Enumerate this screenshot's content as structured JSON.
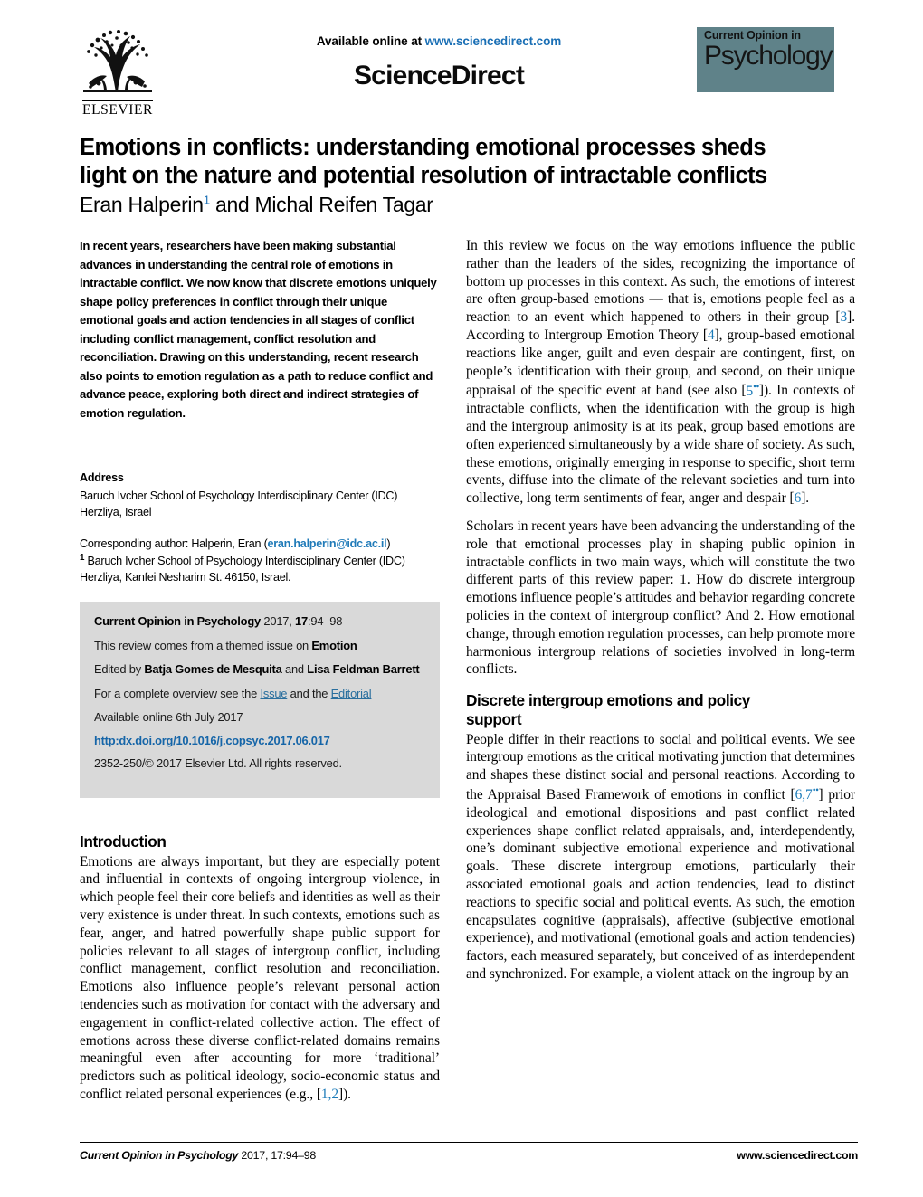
{
  "masthead": {
    "available_prefix": "Available online at ",
    "available_url": "www.sciencedirect.com",
    "sciencedirect_wordmark": "ScienceDirect",
    "elsevier_name": "ELSEVIER",
    "journal_logo_small": "Current Opinion in",
    "journal_logo_big": "Psychology",
    "journal_logo_bg": "#5f8289"
  },
  "title": {
    "line1": "Emotions in conflicts: understanding emotional processes sheds",
    "line2": "light on the nature and potential resolution of intractable conflicts",
    "authors_pre": "Eran Halperin",
    "authors_sup": "1",
    "authors_post": " and Michal Reifen Tagar"
  },
  "abstract": {
    "text": "In recent years, researchers have been making substantial advances in understanding the central role of emotions in intractable conflict. We now know that discrete emotions uniquely shape policy preferences in conflict through their unique emotional goals and action tendencies in all stages of conflict including conflict management, conflict resolution and reconciliation. Drawing on this understanding, recent research also points to emotion regulation as a path to reduce conflict and advance peace, exploring both direct and indirect strategies of emotion regulation."
  },
  "address": {
    "heading": "Address",
    "line1": "Baruch Ivcher School of Psychology Interdisciplinary Center (IDC)",
    "line2": "Herzliya, Israel",
    "corresponding_prefix": "Corresponding author: Halperin, Eran (",
    "corresponding_email": "eran.halperin@idc.ac.il",
    "corresponding_suffix": ")",
    "footnote_marker": "1",
    "footnote_line1": " Baruch Ivcher School of Psychology Interdisciplinary Center (IDC)",
    "footnote_line2": "Herzliya, Kanfei Nesharim St. 46150, Israel."
  },
  "meta": {
    "citation_journal": "Current Opinion in Psychology",
    "citation_year": " 2017, ",
    "citation_volume": "17",
    "citation_pages": ":94–98",
    "themed_prefix": "This review comes from a themed issue on ",
    "themed_topic": "Emotion",
    "edited_prefix": "Edited by ",
    "editor1": "Batja Gomes de Mesquita",
    "edited_join": " and ",
    "editor2": "Lisa Feldman Barrett",
    "overview_prefix": "For a complete overview see the ",
    "overview_link1": "Issue",
    "overview_join": " and the ",
    "overview_link2": "Editorial",
    "available_online": "Available online 6th July 2017",
    "doi": "http:dx.doi.org/10.1016/j.copsyc.2017.06.017",
    "copyright": "2352-250/© 2017 Elsevier Ltd. All rights reserved."
  },
  "left_column": {
    "intro_heading": "Introduction",
    "intro_p1_a": "Emotions are always important, but they are especially potent and influential in contexts of ongoing intergroup violence, in which people feel their core beliefs and identities as well as their very existence is under threat. In such contexts, emotions such as fear, anger, and hatred powerfully shape public support for policies relevant to all stages of intergroup conflict, including conflict management, conflict resolution and reconciliation. Emotions also influence people’s relevant personal action tendencies such as motivation for contact with the adversary and engagement in conflict-related collective action. The effect of emotions across these diverse conflict-related domains remains meaningful even after accounting for more ‘traditional’ predictors such as political ideology, socio-economic status and conflict related personal experiences (e.g., [",
    "intro_p1_ref": "1,2",
    "intro_p1_b": "])."
  },
  "right_column": {
    "p1_a": "In this review we focus on the way emotions influence the public rather than the leaders of the sides, recognizing the importance of bottom up processes in this context. As such, the emotions of interest are often group-based emotions — that is, emotions people feel as a reaction to an event which happened to others in their group [",
    "p1_ref1": "3",
    "p1_b": "]. According to Intergroup Emotion Theory [",
    "p1_ref2": "4",
    "p1_c": "], group-based emotional reactions like anger, guilt and even despair are contingent, first, on people’s identification with their group, and second, on their unique appraisal of the specific event at hand (see also [",
    "p1_ref3": "5",
    "p1_ref3_sup": "••",
    "p1_d": "]). In contexts of intractable conflicts, when the identification with the group is high and the intergroup animosity is at its peak, group based emotions are often experienced simultaneously by a wide share of society. As such, these emotions, originally emerging in response to specific, short term events, diffuse into the climate of the relevant societies and turn into collective, long term sentiments of fear, anger and despair [",
    "p1_ref4": "6",
    "p1_e": "].",
    "p2": "Scholars in recent years have been advancing the understanding of the role that emotional processes play in shaping public opinion in intractable conflicts in two main ways, which will constitute the two different parts of this review paper: 1. How do discrete intergroup emotions influence people’s attitudes and behavior regarding concrete policies in the context of intergroup conflict? And 2. How emotional change, through emotion regulation processes, can help promote more harmonious intergroup relations of societies involved in long-term conflicts.",
    "section_heading_line1": "Discrete intergroup emotions and policy",
    "section_heading_line2": "support",
    "p3_a": "People differ in their reactions to social and political events. We see intergroup emotions as the critical motivating junction that determines and shapes these distinct social and personal reactions. According to the Appraisal Based Framework of emotions in conflict [",
    "p3_ref": "6,7",
    "p3_ref_sup": "••",
    "p3_b": "] prior ideological and emotional dispositions and past conflict related experiences shape conflict related appraisals, and, interdependently, one’s dominant subjective emotional experience and motivational goals. These discrete intergroup emotions, particularly their associated emotional goals and action tendencies, lead to distinct reactions to specific social and political events. As such, the emotion encapsulates cognitive (appraisals), affective (subjective emotional experience), and motivational (emotional goals and action tendencies) factors, each measured separately, but conceived of as interdependent and synchronized. For example, a violent attack on the ingroup by an"
  },
  "footer": {
    "journal_name": "Current Opinion in Psychology",
    "citation": " 2017, 17:94–98",
    "website": "www.sciencedirect.com"
  }
}
